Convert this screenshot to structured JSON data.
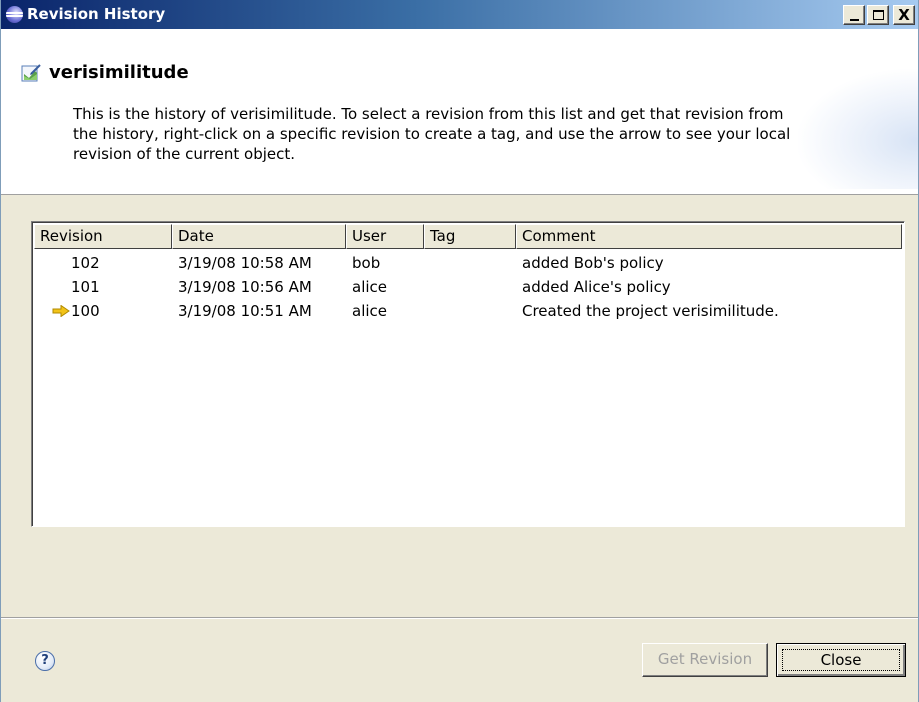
{
  "window": {
    "title": "Revision History",
    "controls": {
      "minimize": "_",
      "maximize": "□",
      "close": "X"
    }
  },
  "header": {
    "object_name": "verisimilitude",
    "description": "This is the history of verisimilitude.  To select a revision from this list and get that revision from the history, right-click on a specific revision to create a tag, and use the arrow to see your local revision of the current object."
  },
  "table": {
    "columns": {
      "revision": "Revision",
      "date": "Date",
      "user": "User",
      "tag": "Tag",
      "comment": "Comment"
    },
    "rows": [
      {
        "revision": "102",
        "date": "3/19/08 10:58 AM",
        "user": "bob",
        "tag": "",
        "comment": "added Bob's policy",
        "current": false
      },
      {
        "revision": "101",
        "date": "3/19/08 10:56 AM",
        "user": "alice",
        "tag": "",
        "comment": "added Alice's policy",
        "current": false
      },
      {
        "revision": "100",
        "date": "3/19/08 10:51 AM",
        "user": "alice",
        "tag": "",
        "comment": "Created the project verisimilitude.",
        "current": true
      }
    ]
  },
  "footer": {
    "help_glyph": "?",
    "get_revision_label": "Get Revision",
    "get_revision_enabled": false,
    "close_label": "Close"
  },
  "icons": {
    "title_icon": "eclipse-icon",
    "object_icon": "file-edit-icon",
    "current_revision_marker": "arrow-right-icon",
    "help": "help-icon"
  },
  "colors": {
    "title_bar_start": "#0a246a",
    "title_bar_end": "#a6caf0",
    "current_arrow": "#f2c318",
    "disabled_text": "#a0a0a0"
  }
}
